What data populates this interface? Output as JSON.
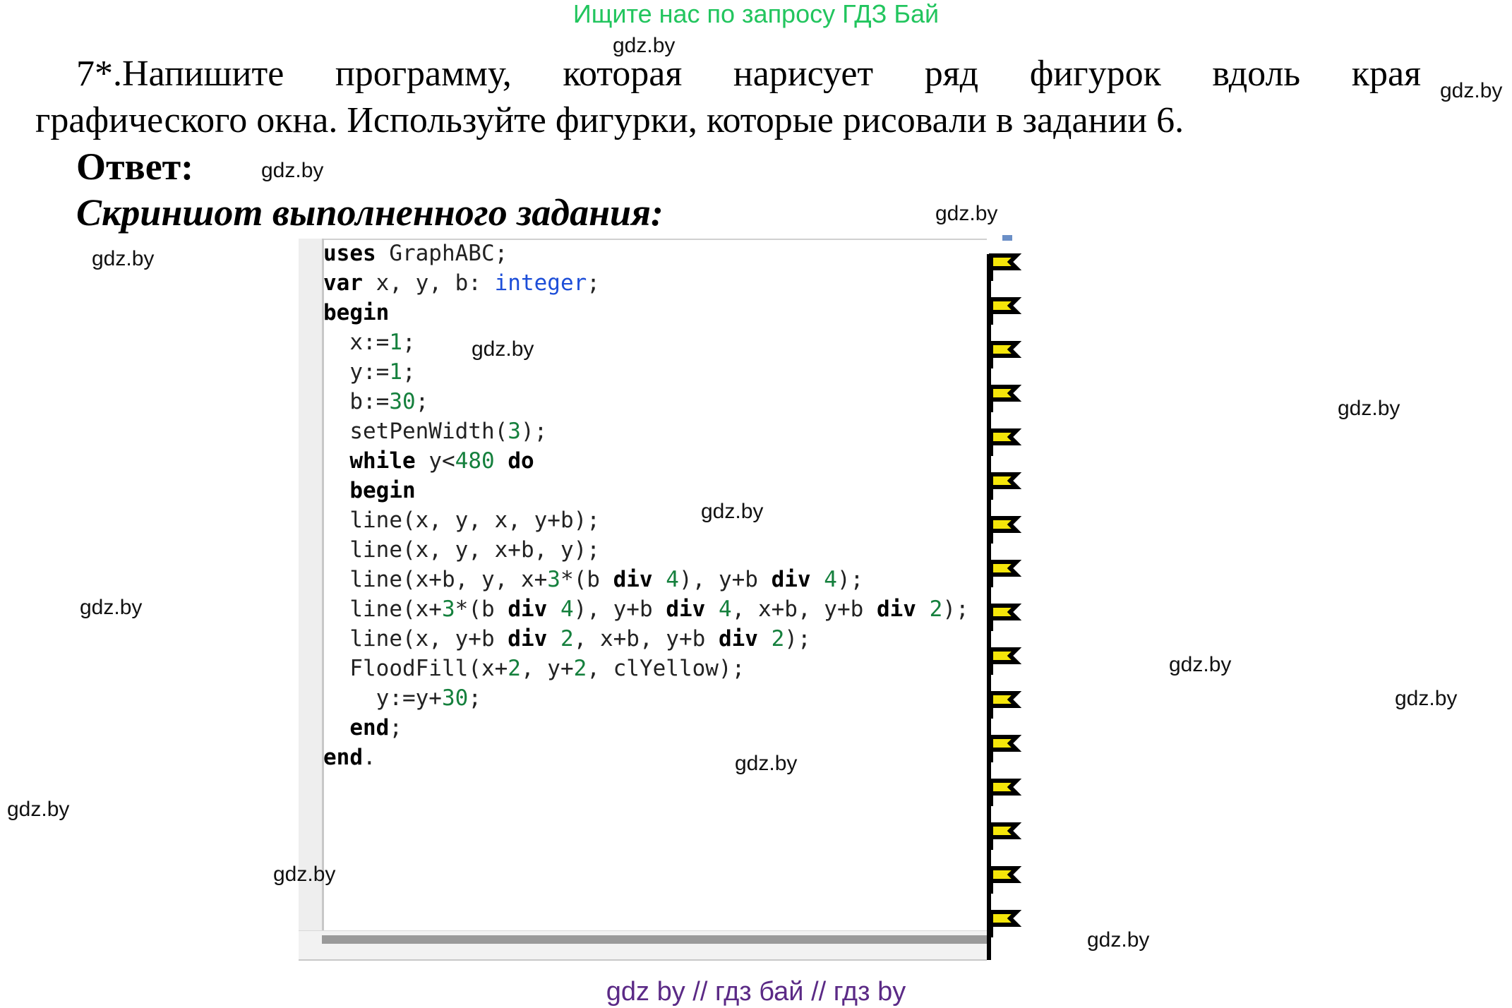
{
  "banner": "Ищите нас по запросу ГДЗ Бай",
  "task": {
    "line1": "7*.Напишите программу, которая нарисует ряд фигурок вдоль края",
    "line2": "графического окна. Используйте фигурки, которые рисовали в задании 6."
  },
  "answer_label": "Ответ:",
  "caption": "Скриншот выполненного задания:",
  "code_lines": [
    [
      {
        "t": "uses",
        "c": "kw"
      },
      {
        "t": " GraphABC;",
        "c": ""
      }
    ],
    [
      {
        "t": "var",
        "c": "kw"
      },
      {
        "t": " x, y, b: ",
        "c": ""
      },
      {
        "t": "integer",
        "c": "ty"
      },
      {
        "t": ";",
        "c": ""
      }
    ],
    [
      {
        "t": "begin",
        "c": "kw"
      }
    ],
    [
      {
        "t": "  x:=",
        "c": ""
      },
      {
        "t": "1",
        "c": "num"
      },
      {
        "t": ";",
        "c": ""
      }
    ],
    [
      {
        "t": "  y:=",
        "c": ""
      },
      {
        "t": "1",
        "c": "num"
      },
      {
        "t": ";",
        "c": ""
      }
    ],
    [
      {
        "t": "  b:=",
        "c": ""
      },
      {
        "t": "30",
        "c": "num"
      },
      {
        "t": ";",
        "c": ""
      }
    ],
    [
      {
        "t": "  setPenWidth(",
        "c": ""
      },
      {
        "t": "3",
        "c": "num"
      },
      {
        "t": ");",
        "c": ""
      }
    ],
    [
      {
        "t": "  ",
        "c": ""
      },
      {
        "t": "while",
        "c": "kw"
      },
      {
        "t": " y<",
        "c": ""
      },
      {
        "t": "480",
        "c": "num"
      },
      {
        "t": " ",
        "c": ""
      },
      {
        "t": "do",
        "c": "kw"
      }
    ],
    [
      {
        "t": "  ",
        "c": ""
      },
      {
        "t": "begin",
        "c": "kw"
      }
    ],
    [
      {
        "t": "  line(x, y, x, y+b);",
        "c": ""
      }
    ],
    [
      {
        "t": "  line(x, y, x+b, y);",
        "c": ""
      }
    ],
    [
      {
        "t": "  line(x+b, y, x+",
        "c": ""
      },
      {
        "t": "3",
        "c": "num"
      },
      {
        "t": "*(b ",
        "c": ""
      },
      {
        "t": "div",
        "c": "kw"
      },
      {
        "t": " ",
        "c": ""
      },
      {
        "t": "4",
        "c": "num"
      },
      {
        "t": "), y+b ",
        "c": ""
      },
      {
        "t": "div",
        "c": "kw"
      },
      {
        "t": " ",
        "c": ""
      },
      {
        "t": "4",
        "c": "num"
      },
      {
        "t": ");",
        "c": ""
      }
    ],
    [
      {
        "t": "  line(x+",
        "c": ""
      },
      {
        "t": "3",
        "c": "num"
      },
      {
        "t": "*(b ",
        "c": ""
      },
      {
        "t": "div",
        "c": "kw"
      },
      {
        "t": " ",
        "c": ""
      },
      {
        "t": "4",
        "c": "num"
      },
      {
        "t": "), y+b ",
        "c": ""
      },
      {
        "t": "div",
        "c": "kw"
      },
      {
        "t": " ",
        "c": ""
      },
      {
        "t": "4",
        "c": "num"
      },
      {
        "t": ", x+b, y+b ",
        "c": ""
      },
      {
        "t": "div",
        "c": "kw"
      },
      {
        "t": " ",
        "c": ""
      },
      {
        "t": "2",
        "c": "num"
      },
      {
        "t": ");",
        "c": ""
      }
    ],
    [
      {
        "t": "  line(x, y+b ",
        "c": ""
      },
      {
        "t": "div",
        "c": "kw"
      },
      {
        "t": " ",
        "c": ""
      },
      {
        "t": "2",
        "c": "num"
      },
      {
        "t": ", x+b, y+b ",
        "c": ""
      },
      {
        "t": "div",
        "c": "kw"
      },
      {
        "t": " ",
        "c": ""
      },
      {
        "t": "2",
        "c": "num"
      },
      {
        "t": ");",
        "c": ""
      }
    ],
    [
      {
        "t": "  FloodFill(x+",
        "c": ""
      },
      {
        "t": "2",
        "c": "num"
      },
      {
        "t": ", y+",
        "c": ""
      },
      {
        "t": "2",
        "c": "num"
      },
      {
        "t": ", clYellow);",
        "c": ""
      }
    ],
    [
      {
        "t": "    y:=y+",
        "c": ""
      },
      {
        "t": "30",
        "c": "num"
      },
      {
        "t": ";",
        "c": ""
      }
    ],
    [
      {
        "t": "  ",
        "c": ""
      },
      {
        "t": "end",
        "c": "kw"
      },
      {
        "t": ";",
        "c": ""
      }
    ],
    [
      {
        "t": "end",
        "c": "kw"
      },
      {
        "t": ".",
        "c": ""
      }
    ]
  ],
  "graphics_window": {
    "flag_count": 16,
    "flag_fill": "#f5e60a",
    "stroke": "#000000"
  },
  "watermarks": [
    "gdz.by",
    "gdz.by",
    "gdz.by",
    "gdz.by",
    "gdz.by",
    "gdz.by",
    "gdz.by",
    "gdz.by",
    "gdz.by",
    "gdz.by",
    "gdz.by",
    "gdz.by",
    "gdz.by",
    "gdz.by"
  ],
  "footer": "gdz by  //  гдз бай  //  гдз by",
  "colors": {
    "banner": "#22c55e",
    "footer": "#5b2a86",
    "keyword_type": "#1d4ed8",
    "number": "#15803d"
  }
}
